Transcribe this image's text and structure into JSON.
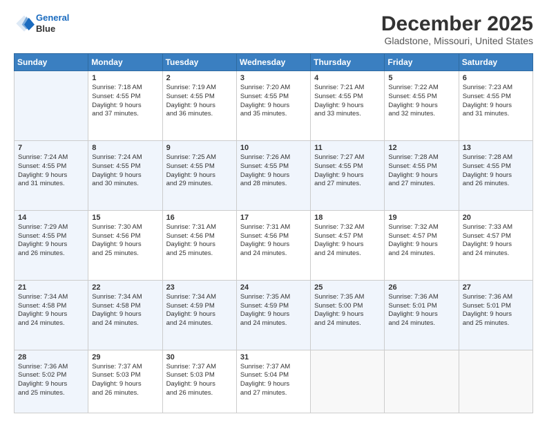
{
  "logo": {
    "line1": "General",
    "line2": "Blue"
  },
  "title": "December 2025",
  "subtitle": "Gladstone, Missouri, United States",
  "days_header": [
    "Sunday",
    "Monday",
    "Tuesday",
    "Wednesday",
    "Thursday",
    "Friday",
    "Saturday"
  ],
  "weeks": [
    [
      {
        "num": "",
        "info": ""
      },
      {
        "num": "1",
        "info": "Sunrise: 7:18 AM\nSunset: 4:55 PM\nDaylight: 9 hours\nand 37 minutes."
      },
      {
        "num": "2",
        "info": "Sunrise: 7:19 AM\nSunset: 4:55 PM\nDaylight: 9 hours\nand 36 minutes."
      },
      {
        "num": "3",
        "info": "Sunrise: 7:20 AM\nSunset: 4:55 PM\nDaylight: 9 hours\nand 35 minutes."
      },
      {
        "num": "4",
        "info": "Sunrise: 7:21 AM\nSunset: 4:55 PM\nDaylight: 9 hours\nand 33 minutes."
      },
      {
        "num": "5",
        "info": "Sunrise: 7:22 AM\nSunset: 4:55 PM\nDaylight: 9 hours\nand 32 minutes."
      },
      {
        "num": "6",
        "info": "Sunrise: 7:23 AM\nSunset: 4:55 PM\nDaylight: 9 hours\nand 31 minutes."
      }
    ],
    [
      {
        "num": "7",
        "info": "Sunrise: 7:24 AM\nSunset: 4:55 PM\nDaylight: 9 hours\nand 31 minutes."
      },
      {
        "num": "8",
        "info": "Sunrise: 7:24 AM\nSunset: 4:55 PM\nDaylight: 9 hours\nand 30 minutes."
      },
      {
        "num": "9",
        "info": "Sunrise: 7:25 AM\nSunset: 4:55 PM\nDaylight: 9 hours\nand 29 minutes."
      },
      {
        "num": "10",
        "info": "Sunrise: 7:26 AM\nSunset: 4:55 PM\nDaylight: 9 hours\nand 28 minutes."
      },
      {
        "num": "11",
        "info": "Sunrise: 7:27 AM\nSunset: 4:55 PM\nDaylight: 9 hours\nand 27 minutes."
      },
      {
        "num": "12",
        "info": "Sunrise: 7:28 AM\nSunset: 4:55 PM\nDaylight: 9 hours\nand 27 minutes."
      },
      {
        "num": "13",
        "info": "Sunrise: 7:28 AM\nSunset: 4:55 PM\nDaylight: 9 hours\nand 26 minutes."
      }
    ],
    [
      {
        "num": "14",
        "info": "Sunrise: 7:29 AM\nSunset: 4:55 PM\nDaylight: 9 hours\nand 26 minutes."
      },
      {
        "num": "15",
        "info": "Sunrise: 7:30 AM\nSunset: 4:56 PM\nDaylight: 9 hours\nand 25 minutes."
      },
      {
        "num": "16",
        "info": "Sunrise: 7:31 AM\nSunset: 4:56 PM\nDaylight: 9 hours\nand 25 minutes."
      },
      {
        "num": "17",
        "info": "Sunrise: 7:31 AM\nSunset: 4:56 PM\nDaylight: 9 hours\nand 24 minutes."
      },
      {
        "num": "18",
        "info": "Sunrise: 7:32 AM\nSunset: 4:57 PM\nDaylight: 9 hours\nand 24 minutes."
      },
      {
        "num": "19",
        "info": "Sunrise: 7:32 AM\nSunset: 4:57 PM\nDaylight: 9 hours\nand 24 minutes."
      },
      {
        "num": "20",
        "info": "Sunrise: 7:33 AM\nSunset: 4:57 PM\nDaylight: 9 hours\nand 24 minutes."
      }
    ],
    [
      {
        "num": "21",
        "info": "Sunrise: 7:34 AM\nSunset: 4:58 PM\nDaylight: 9 hours\nand 24 minutes."
      },
      {
        "num": "22",
        "info": "Sunrise: 7:34 AM\nSunset: 4:58 PM\nDaylight: 9 hours\nand 24 minutes."
      },
      {
        "num": "23",
        "info": "Sunrise: 7:34 AM\nSunset: 4:59 PM\nDaylight: 9 hours\nand 24 minutes."
      },
      {
        "num": "24",
        "info": "Sunrise: 7:35 AM\nSunset: 4:59 PM\nDaylight: 9 hours\nand 24 minutes."
      },
      {
        "num": "25",
        "info": "Sunrise: 7:35 AM\nSunset: 5:00 PM\nDaylight: 9 hours\nand 24 minutes."
      },
      {
        "num": "26",
        "info": "Sunrise: 7:36 AM\nSunset: 5:01 PM\nDaylight: 9 hours\nand 24 minutes."
      },
      {
        "num": "27",
        "info": "Sunrise: 7:36 AM\nSunset: 5:01 PM\nDaylight: 9 hours\nand 25 minutes."
      }
    ],
    [
      {
        "num": "28",
        "info": "Sunrise: 7:36 AM\nSunset: 5:02 PM\nDaylight: 9 hours\nand 25 minutes."
      },
      {
        "num": "29",
        "info": "Sunrise: 7:37 AM\nSunset: 5:03 PM\nDaylight: 9 hours\nand 26 minutes."
      },
      {
        "num": "30",
        "info": "Sunrise: 7:37 AM\nSunset: 5:03 PM\nDaylight: 9 hours\nand 26 minutes."
      },
      {
        "num": "31",
        "info": "Sunrise: 7:37 AM\nSunset: 5:04 PM\nDaylight: 9 hours\nand 27 minutes."
      },
      {
        "num": "",
        "info": ""
      },
      {
        "num": "",
        "info": ""
      },
      {
        "num": "",
        "info": ""
      }
    ]
  ]
}
